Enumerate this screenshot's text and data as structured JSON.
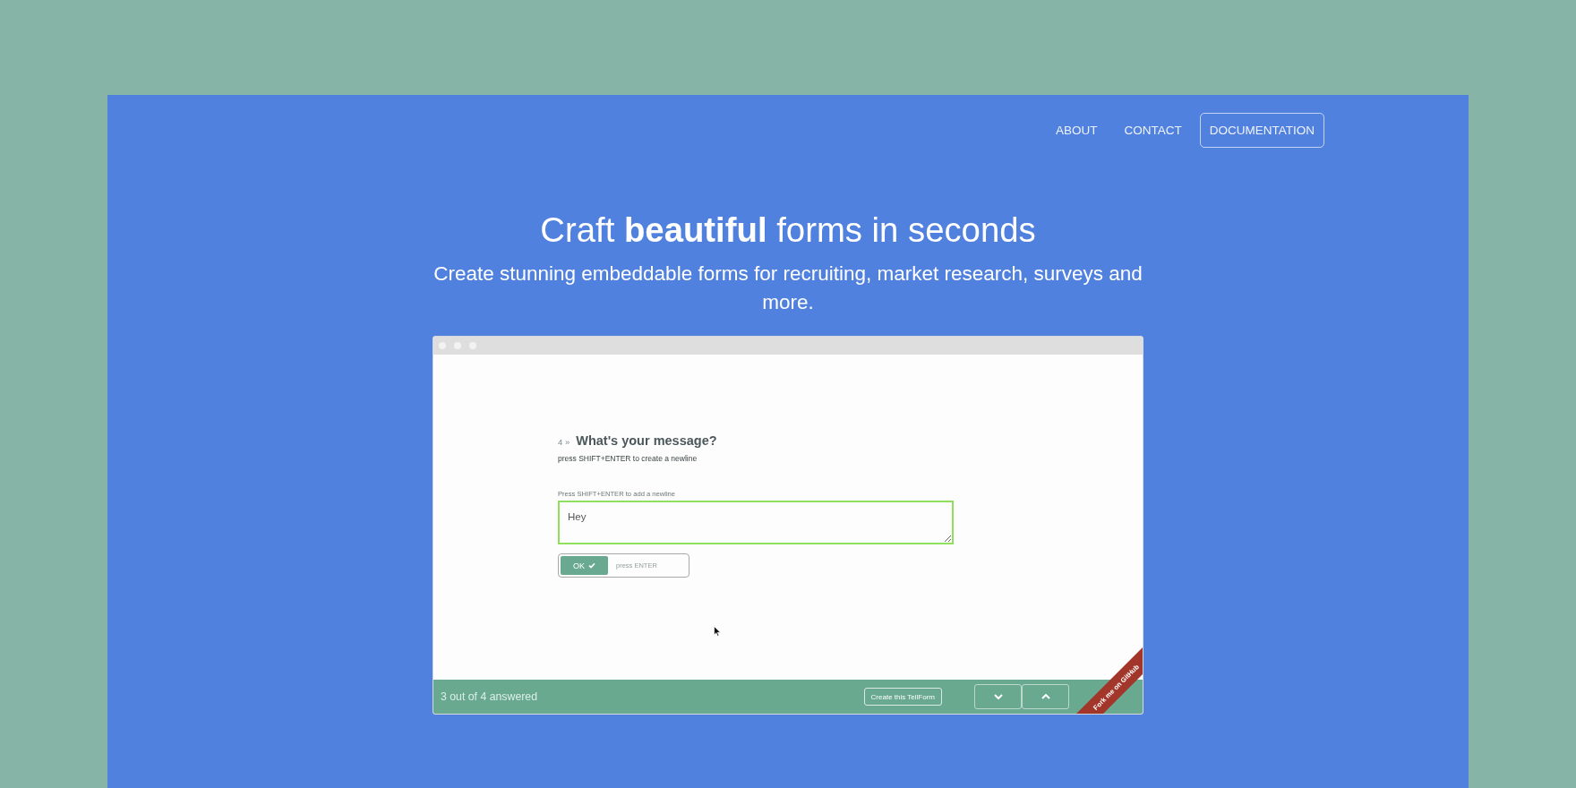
{
  "nav": {
    "links": [
      {
        "label": "ABOUT"
      },
      {
        "label": "CONTACT"
      }
    ],
    "button": {
      "label": "DOCUMENTATION"
    }
  },
  "hero": {
    "title": "Craft **beautiful** forms in seconds",
    "subtitle": "Create stunning embeddable forms for recruiting, market research, surveys and more."
  },
  "form_preview": {
    "question": {
      "number": "4 »",
      "title": "What's your message?",
      "description": "press SHIFT+ENTER to create a newline"
    },
    "answer": {
      "hint": "Press SHIFT+ENTER to add a newline",
      "value": "Hey",
      "focused": true
    },
    "ok_button": {
      "label": "OK"
    },
    "ok_hint": "press ENTER",
    "footer": {
      "progress": "3 out of 4 answered",
      "create_button": "Create this TellForm"
    },
    "ribbon": "Fork me on GitHub"
  }
}
